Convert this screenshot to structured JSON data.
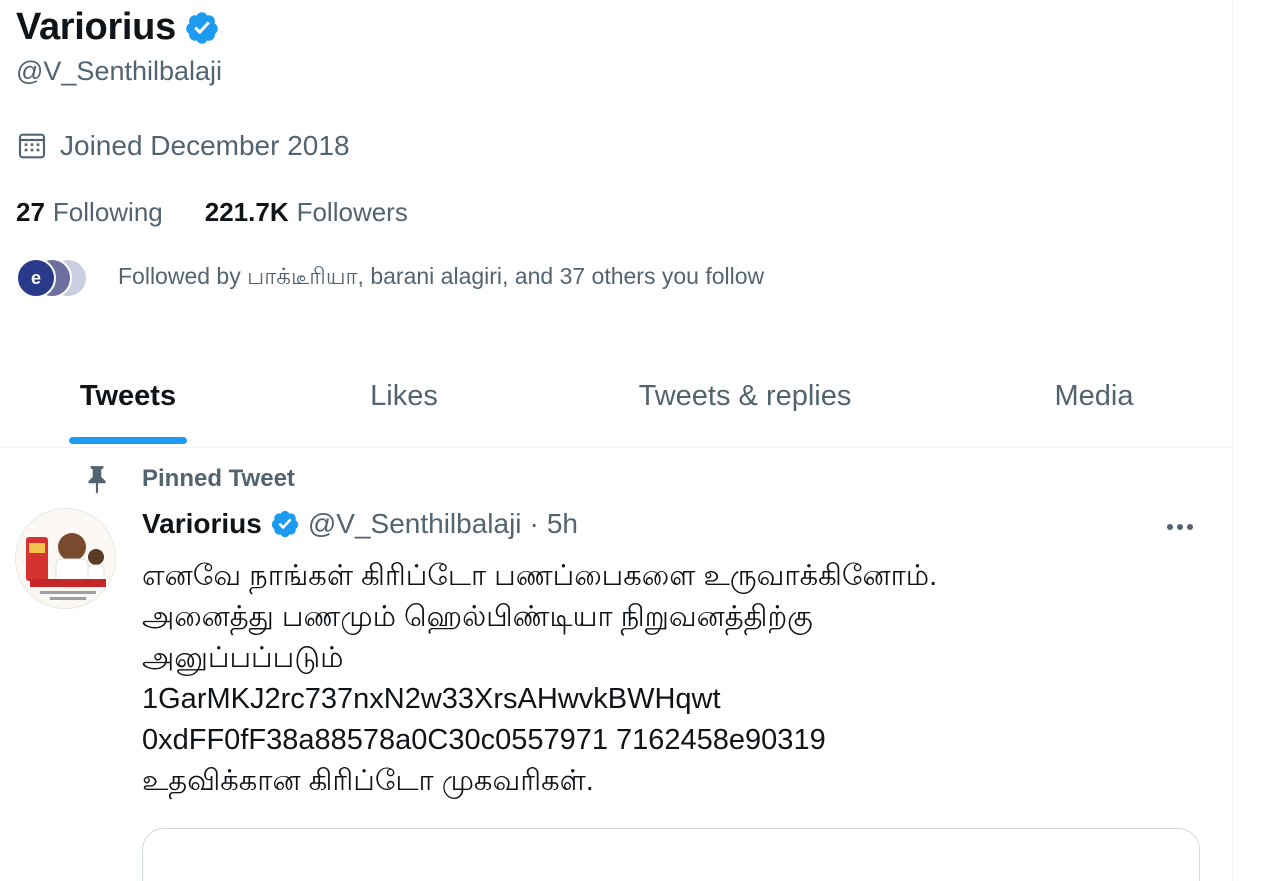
{
  "profile": {
    "display_name": "Variorius",
    "handle": "@V_Senthilbalaji",
    "joined": "Joined December 2018",
    "following_count": "27",
    "following_label": "Following",
    "followers_count": "221.7K",
    "followers_label": "Followers",
    "followed_by": "Followed by பாக்டீரியா, barani alagiri, and 37 others you follow"
  },
  "tabs": [
    {
      "label": "Tweets",
      "active": true
    },
    {
      "label": "Likes",
      "active": false
    },
    {
      "label": "Tweets & replies",
      "active": false
    },
    {
      "label": "Media",
      "active": false
    }
  ],
  "tweet": {
    "pinned_label": "Pinned Tweet",
    "author_name": "Variorius",
    "author_handle": "@V_Senthilbalaji",
    "separator": "·",
    "time": "5h",
    "lines": [
      "எனவே நாங்கள் கிரிப்டோ பணப்பைகளை உருவாக்கினோம்.",
      "அனைத்து பணமும் ஹெல்பிண்டியா நிறுவனத்திற்கு",
      "அனுப்பப்படும்",
      "1GarMKJ2rc737nxN2w33XrsAHwvkBWHqwt",
      "0xdFF0fF38a88578a0C30c0557971 7162458e90319",
      "உதவிக்கான கிரிப்டோ முகவரிகள்."
    ]
  },
  "colors": {
    "accent": "#1d9bf0",
    "text_primary": "#0f1419",
    "text_secondary": "#536471"
  },
  "icons": [
    "verified-badge-icon",
    "calendar-icon",
    "pin-icon",
    "more-icon"
  ]
}
